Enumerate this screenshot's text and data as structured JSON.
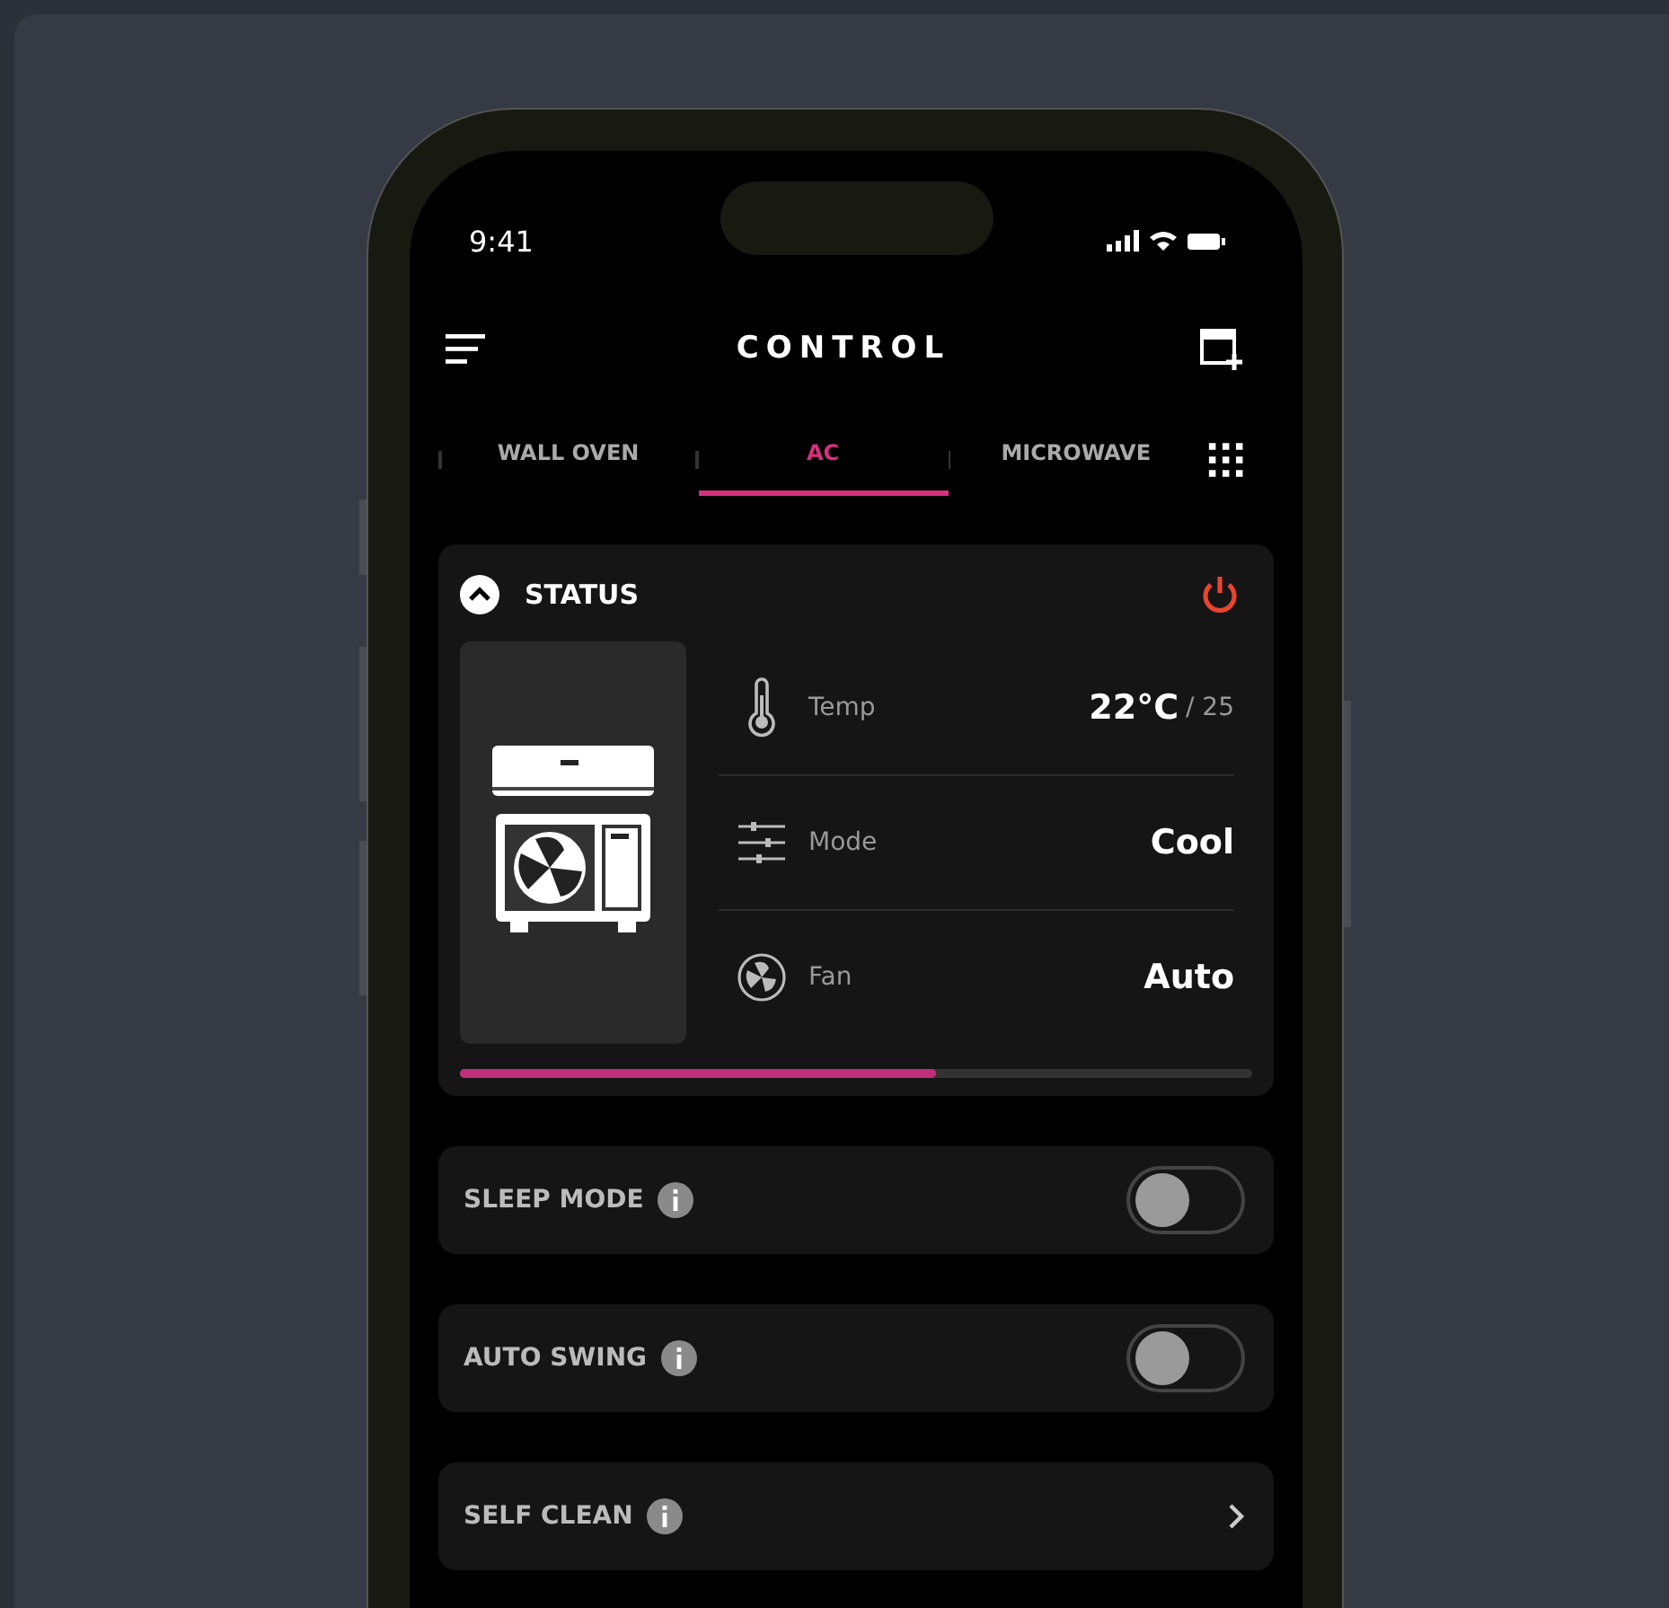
{
  "status_bar": {
    "time": "9:41"
  },
  "header": {
    "title": "CONTROL"
  },
  "tabs": [
    {
      "label": "WALL OVEN",
      "selected": false
    },
    {
      "label": "AC",
      "selected": true
    },
    {
      "label": "MICROWAVE",
      "selected": false
    }
  ],
  "status_card": {
    "title": "STATUS",
    "expanded": true,
    "power_on": true,
    "readings": [
      {
        "kind": "temp",
        "label": "Temp",
        "value": "22°C",
        "sub": "/ 25"
      },
      {
        "kind": "mode",
        "label": "Mode",
        "value": "Cool"
      },
      {
        "kind": "fan",
        "label": "Fan",
        "value": "Auto"
      }
    ],
    "progress": {
      "level": 0.6
    }
  },
  "settings": [
    {
      "kind": "toggle",
      "label": "SLEEP MODE",
      "on": false
    },
    {
      "kind": "toggle",
      "label": "AUTO SWING",
      "on": false
    },
    {
      "kind": "link",
      "label": "SELF CLEAN"
    }
  ]
}
